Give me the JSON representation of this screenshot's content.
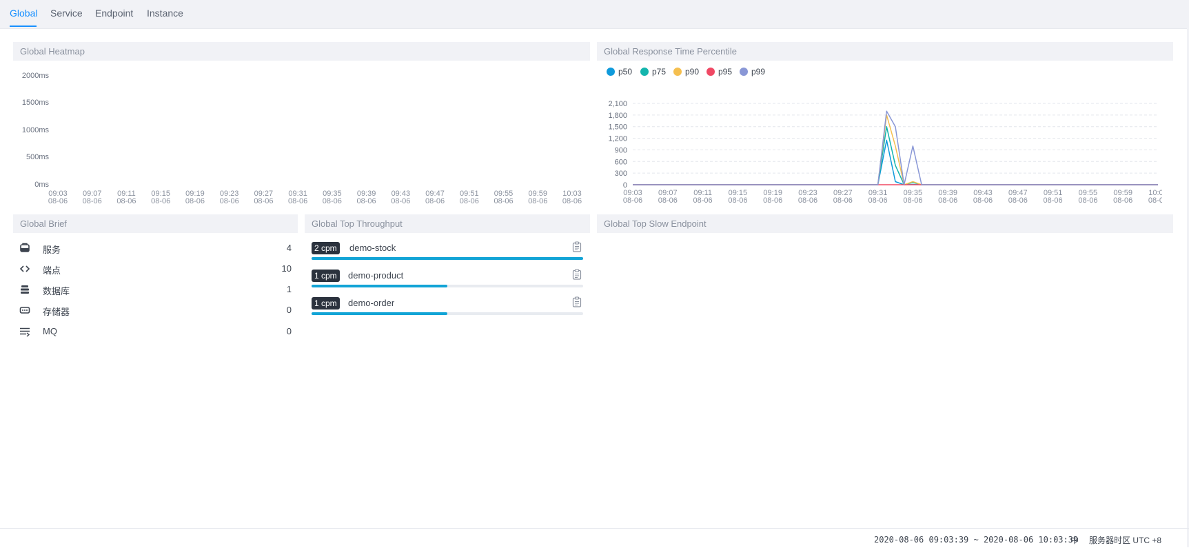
{
  "tabs": [
    {
      "label": "Global",
      "active": true
    },
    {
      "label": "Service",
      "active": false
    },
    {
      "label": "Endpoint",
      "active": false
    },
    {
      "label": "Instance",
      "active": false
    }
  ],
  "heatmap": {
    "title": "Global Heatmap",
    "y_labels": [
      "2000ms",
      "1500ms",
      "1000ms",
      "500ms",
      "0ms"
    ]
  },
  "time_ticks": [
    "09:03",
    "09:07",
    "09:11",
    "09:15",
    "09:19",
    "09:23",
    "09:27",
    "09:31",
    "09:35",
    "09:39",
    "09:43",
    "09:47",
    "09:51",
    "09:55",
    "09:59",
    "10:03"
  ],
  "date_tick": "08-06",
  "percentile": {
    "title": "Global Response Time Percentile",
    "colors": {
      "p50": "#0f9adb",
      "p75": "#13b5ad",
      "p90": "#f5bf4f",
      "p95": "#f04864",
      "p99": "#8997d6"
    }
  },
  "chart_data": {
    "type": "line",
    "title": "Global Response Time Percentile",
    "xlabel": "",
    "ylabel": "",
    "x": [
      "09:03",
      "09:07",
      "09:11",
      "09:15",
      "09:19",
      "09:23",
      "09:27",
      "09:31",
      "09:32",
      "09:33",
      "09:34",
      "09:35",
      "09:36",
      "10:03"
    ],
    "ylim": [
      0,
      2100
    ],
    "yticks": [
      "2,100",
      "1,800",
      "1,500",
      "1,200",
      "900",
      "600",
      "300",
      "0"
    ],
    "grid": true,
    "legend_position": "top-left",
    "series": [
      {
        "name": "p50",
        "values": [
          0,
          0,
          0,
          0,
          0,
          0,
          0,
          0,
          1150,
          80,
          0,
          10,
          0,
          0
        ]
      },
      {
        "name": "p75",
        "values": [
          0,
          0,
          0,
          0,
          0,
          0,
          0,
          0,
          1500,
          500,
          0,
          60,
          0,
          0
        ]
      },
      {
        "name": "p90",
        "values": [
          0,
          0,
          0,
          0,
          0,
          0,
          0,
          0,
          1800,
          1000,
          0,
          80,
          0,
          0
        ]
      },
      {
        "name": "p95",
        "values": [
          0,
          0,
          0,
          0,
          0,
          0,
          0,
          0,
          0,
          0,
          0,
          0,
          0,
          0
        ]
      },
      {
        "name": "p99",
        "values": [
          0,
          0,
          0,
          0,
          0,
          0,
          0,
          0,
          1900,
          1500,
          0,
          1000,
          0,
          0
        ]
      }
    ]
  },
  "brief": {
    "title": "Global Brief",
    "items": [
      {
        "icon": "server-icon",
        "label": "服务",
        "value": "4"
      },
      {
        "icon": "code-icon",
        "label": "端点",
        "value": "10"
      },
      {
        "icon": "database-icon",
        "label": "数据库",
        "value": "1"
      },
      {
        "icon": "cache-icon",
        "label": "存储器",
        "value": "0"
      },
      {
        "icon": "mq-icon",
        "label": "MQ",
        "value": "0"
      }
    ]
  },
  "throughput": {
    "title": "Global Top Throughput",
    "items": [
      {
        "badge": "2 cpm",
        "name": "demo-stock",
        "ratio": 1.0
      },
      {
        "badge": "1 cpm",
        "name": "demo-product",
        "ratio": 0.5
      },
      {
        "badge": "1 cpm",
        "name": "demo-order",
        "ratio": 0.5
      }
    ],
    "bar_color": "#12a4d6"
  },
  "slow_endpoint": {
    "title": "Global Top Slow Endpoint"
  },
  "footer": {
    "time_range": "2020-08-06 09:03:39 ~ 2020-08-06 10:03:39",
    "lang": "中",
    "timezone": "服务器时区 UTC +8"
  },
  "accent_color": "#1890ff"
}
